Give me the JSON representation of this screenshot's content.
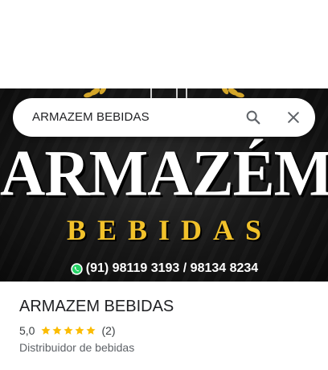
{
  "search": {
    "query": "ARMAZEM BEBIDAS",
    "search_icon": "search-icon",
    "close_icon": "close-icon"
  },
  "hero": {
    "title": "ARMAZÉM",
    "subtitle": "BEBIDAS",
    "phone": "(91) 98119 3193 / 98134 8234",
    "phone_icon": "whatsapp-icon",
    "colors": {
      "title": "#ffffff",
      "subtitle": "#f2c22b",
      "background": "#151515"
    }
  },
  "place": {
    "name": "ARMAZEM BEBIDAS",
    "rating": "5,0",
    "rating_value": 5,
    "stars_max": 5,
    "review_count": "(2)",
    "category": "Distribuidor de bebidas",
    "star_color": "#fbbc04"
  }
}
